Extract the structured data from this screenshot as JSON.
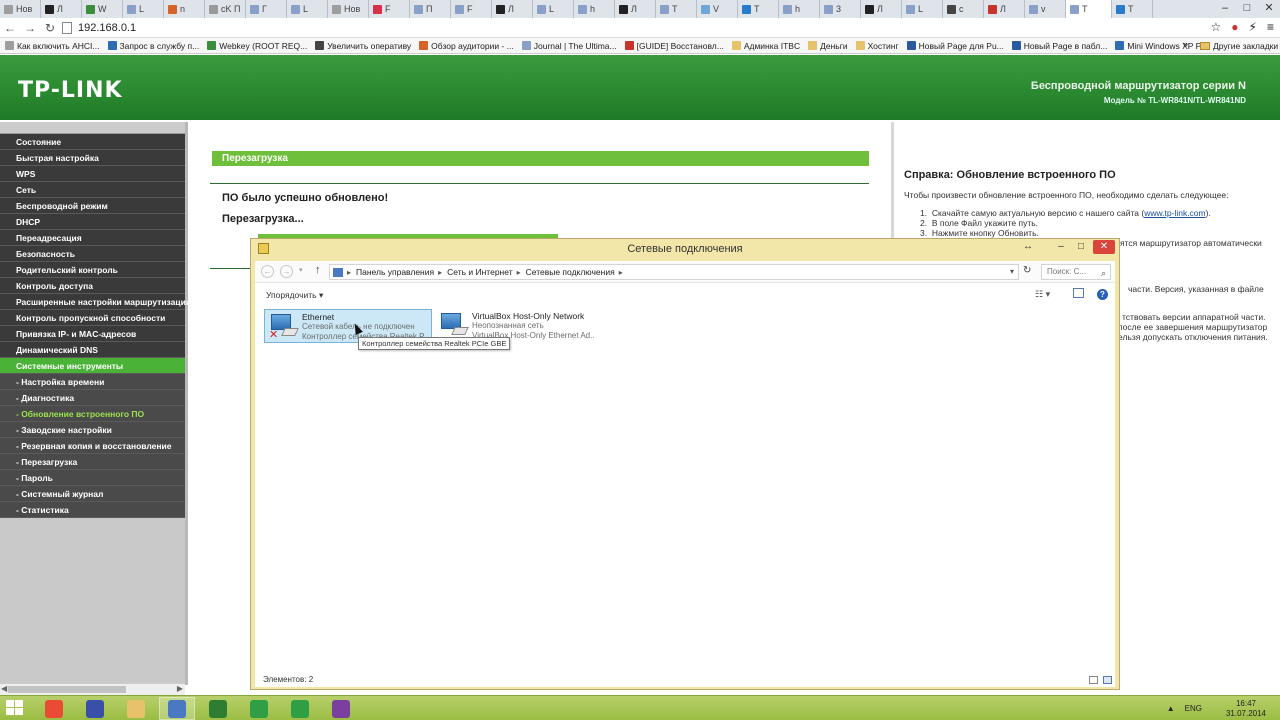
{
  "browser": {
    "tabs": [
      {
        "label": "Нов",
        "color": "#9e9e9e"
      },
      {
        "label": "Л",
        "color": "#222222"
      },
      {
        "label": "W",
        "color": "#3c8d3c"
      },
      {
        "label": "L",
        "color": "#8aa0c8"
      },
      {
        "label": "n",
        "color": "#d4632a"
      },
      {
        "label": "cK П",
        "color": "#9a9a9a"
      },
      {
        "label": "Г",
        "color": "#8aa0c8"
      },
      {
        "label": "L",
        "color": "#8aa0c8"
      },
      {
        "label": "Нов",
        "color": "#9e9e9e"
      },
      {
        "label": "F",
        "color": "#d9304a"
      },
      {
        "label": "П",
        "color": "#8aa0c8"
      },
      {
        "label": "F",
        "color": "#8aa0c8"
      },
      {
        "label": "Л",
        "color": "#222222"
      },
      {
        "label": "L",
        "color": "#8aa0c8"
      },
      {
        "label": "h",
        "color": "#8aa0c8"
      },
      {
        "label": "Л",
        "color": "#222222"
      },
      {
        "label": "T",
        "color": "#8aa0c8"
      },
      {
        "label": "V",
        "color": "#6ea6d8"
      },
      {
        "label": "T",
        "color": "#2a7bc8"
      },
      {
        "label": "h",
        "color": "#8aa0c8"
      },
      {
        "label": "3",
        "color": "#8aa0c8"
      },
      {
        "label": "Л",
        "color": "#222222"
      },
      {
        "label": "L",
        "color": "#8aa0c8"
      },
      {
        "label": "c",
        "color": "#444444"
      },
      {
        "label": "Л",
        "color": "#c8332c"
      },
      {
        "label": "v",
        "color": "#8aa0c8"
      },
      {
        "label": "T",
        "color": "#8aa0c8"
      },
      {
        "label": "T",
        "color": "#2a7bc8"
      }
    ],
    "url": "192.168.0.1",
    "bookmarks": [
      {
        "label": "Как включить AHCI...",
        "color": "#9e9e9e"
      },
      {
        "label": "Запрос в службу п...",
        "color": "#2c6db5"
      },
      {
        "label": "Webkey (ROOT REQ...",
        "color": "#3c8d3c"
      },
      {
        "label": "Увеличить оперативу",
        "color": "#444444"
      },
      {
        "label": "Обзор аудитории - ...",
        "color": "#d4632a"
      },
      {
        "label": "Journal | The Ultima...",
        "color": "#8aa0c8"
      },
      {
        "label": "[GUIDE] Восстановл...",
        "color": "#c8332c"
      },
      {
        "label": "Админка ITBC",
        "color": "#e8c26b"
      },
      {
        "label": "Деньги",
        "color": "#e8c26b"
      },
      {
        "label": "Хостинг",
        "color": "#e8c26b"
      },
      {
        "label": "Новый Page для Pu...",
        "color": "#2c5aa0"
      },
      {
        "label": "Новый Page в пабл...",
        "color": "#2c5aa0"
      },
      {
        "label": "Mini Windows XP Pr...",
        "color": "#2c6db5"
      }
    ],
    "bookmarks_more": "»",
    "bookmarks_other": "Другие закладки"
  },
  "router": {
    "logo": "TP-LINK",
    "title": "Беспроводной маршрутизатор серии N",
    "model": "Модель № TL-WR841N/TL-WR841ND",
    "menu": [
      {
        "label": "Состояние",
        "sub": false
      },
      {
        "label": "Быстрая настройка",
        "sub": false
      },
      {
        "label": "WPS",
        "sub": false
      },
      {
        "label": "Сеть",
        "sub": false
      },
      {
        "label": "Беспроводной режим",
        "sub": false
      },
      {
        "label": "DHCP",
        "sub": false
      },
      {
        "label": "Переадресация",
        "sub": false
      },
      {
        "label": "Безопасность",
        "sub": false
      },
      {
        "label": "Родительский контроль",
        "sub": false
      },
      {
        "label": "Контроль доступа",
        "sub": false
      },
      {
        "label": "Расширенные настройки маршрутизации",
        "sub": false
      },
      {
        "label": "Контроль пропускной способности",
        "sub": false
      },
      {
        "label": "Привязка IP- и MAC-адресов",
        "sub": false
      },
      {
        "label": "Динамический DNS",
        "sub": false
      },
      {
        "label": "Системные инструменты",
        "sub": false,
        "active": true
      },
      {
        "label": "- Настройка времени",
        "sub": true
      },
      {
        "label": "- Диагностика",
        "sub": true
      },
      {
        "label": "- Обновление встроенного ПО",
        "sub": true,
        "current": true
      },
      {
        "label": "- Заводские настройки",
        "sub": true
      },
      {
        "label": "- Резервная копия и восстановление",
        "sub": true
      },
      {
        "label": "- Перезагрузка",
        "sub": true
      },
      {
        "label": "- Пароль",
        "sub": true
      },
      {
        "label": "- Системный журнал",
        "sub": true
      },
      {
        "label": "- Статистика",
        "sub": true
      }
    ],
    "reboot_header": "Перезагрузка",
    "msg_success": "ПО было успешно обновлено!",
    "msg_rebooting": "Перезагрузка...",
    "progress": 0.8,
    "help": {
      "title": "Справка: Обновление встроенного ПО",
      "intro": "Чтобы произвести обновление встроенного ПО, необходимо сделать следующее:",
      "step1_prefix": "Скачайте самую актуальную версию с нашего сайта (",
      "step1_link": "www.tp-link.com",
      "step1_suffix": ").",
      "step2": "В поле Файл укажите путь.",
      "step3": "Нажмите кнопку Обновить.",
      "frag_a": "ятся   маршрутизатор   автоматически",
      "frag_b": "части.  Версия,  указанная  в  файле",
      "frag_c": "тствовать версии аппаратной части.",
      "frag_d": "после ее завершения маршрутизатор",
      "frag_e": "ельзя допускать отключения питания."
    }
  },
  "explorer": {
    "title": "Сетевые подключения",
    "breadcrumb": [
      "Панель управления",
      "Сеть и Интернет",
      "Сетевые подключения"
    ],
    "search_placeholder": "Поиск: С...",
    "organize": "Упорядочить ▾",
    "connections": [
      {
        "name": "Ethernet",
        "status": "Сетевой кабель не подключен",
        "device": "Контроллер семейства Realtek PCIe GBE",
        "error": true
      },
      {
        "name": "VirtualBox Host-Only Network",
        "status": "Неопознанная сеть",
        "device": "VirtualBox Host-Only Ethernet Ad...",
        "error": false
      }
    ],
    "tooltip": "Контроллер семейства Realtek PCIe GBE",
    "status_items": "Элементов: 2"
  },
  "taskbar": {
    "apps": [
      {
        "name": "chrome",
        "color": "#e94b35"
      },
      {
        "name": "save-app",
        "color": "#3a4fa8"
      },
      {
        "name": "file-explorer",
        "color": "#e8c26b"
      },
      {
        "name": "network-connections",
        "color": "#4a78c2"
      },
      {
        "name": "terminal-green",
        "color": "#2e7d32"
      },
      {
        "name": "camtasia-c1",
        "color": "#2f9e44"
      },
      {
        "name": "camtasia-c2",
        "color": "#2f9e44"
      },
      {
        "name": "winrar",
        "color": "#7b3fa0"
      }
    ],
    "lang": "ENG",
    "time": "16:47",
    "date": "31.07.2014"
  }
}
